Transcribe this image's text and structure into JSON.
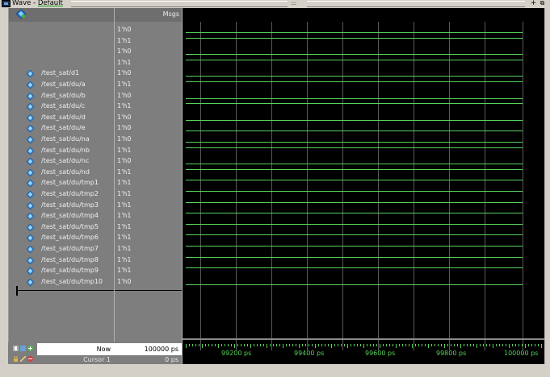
{
  "window": {
    "title_prefix": "Wave - ",
    "title_default": "Default",
    "grip_glyph": "::::::",
    "dock_glyph": "+",
    "undock_glyph": "⧉"
  },
  "header": {
    "msgs": "Msgs"
  },
  "signals": [
    {
      "name": "",
      "value": "1'h0"
    },
    {
      "name": "",
      "value": "1'h1"
    },
    {
      "name": "",
      "value": "1'h0"
    },
    {
      "name": "",
      "value": "1'h1"
    },
    {
      "name": "/test_sat/d1",
      "value": "1'h0"
    },
    {
      "name": "/test_sat/du/a",
      "value": "1'h1"
    },
    {
      "name": "/test_sat/du/b",
      "value": "1'h0"
    },
    {
      "name": "/test_sat/du/c",
      "value": "1'h1"
    },
    {
      "name": "/test_sat/du/d",
      "value": "1'h0"
    },
    {
      "name": "/test_sat/du/e",
      "value": "1'h0"
    },
    {
      "name": "/test_sat/du/na",
      "value": "1'h0"
    },
    {
      "name": "/test_sat/du/nb",
      "value": "1'h1"
    },
    {
      "name": "/test_sat/du/nc",
      "value": "1'h0"
    },
    {
      "name": "/test_sat/du/nd",
      "value": "1'h1"
    },
    {
      "name": "/test_sat/du/tmp1",
      "value": "1'h1"
    },
    {
      "name": "/test_sat/du/tmp2",
      "value": "1'h1"
    },
    {
      "name": "/test_sat/du/tmp3",
      "value": "1'h1"
    },
    {
      "name": "/test_sat/du/tmp4",
      "value": "1'h1"
    },
    {
      "name": "/test_sat/du/tmp5",
      "value": "1'h1"
    },
    {
      "name": "/test_sat/du/tmp6",
      "value": "1'h1"
    },
    {
      "name": "/test_sat/du/tmp7",
      "value": "1'h1"
    },
    {
      "name": "/test_sat/du/tmp8",
      "value": "1'h1"
    },
    {
      "name": "/test_sat/du/tmp9",
      "value": "1'h1"
    },
    {
      "name": "/test_sat/du/tmp10",
      "value": "1'h0"
    }
  ],
  "timeline": {
    "labels": [
      "99200 ps",
      "99400 ps",
      "99600 ps",
      "99800 ps",
      "100000 ps"
    ]
  },
  "footer": {
    "now_label": "Now",
    "now_value": "100000 ps",
    "cursor_label": "Cursor 1",
    "cursor_value": "0 ps"
  },
  "colors": {
    "trace": "#58d35a",
    "panel": "#7e7e7e",
    "wave_bg": "#000000"
  }
}
